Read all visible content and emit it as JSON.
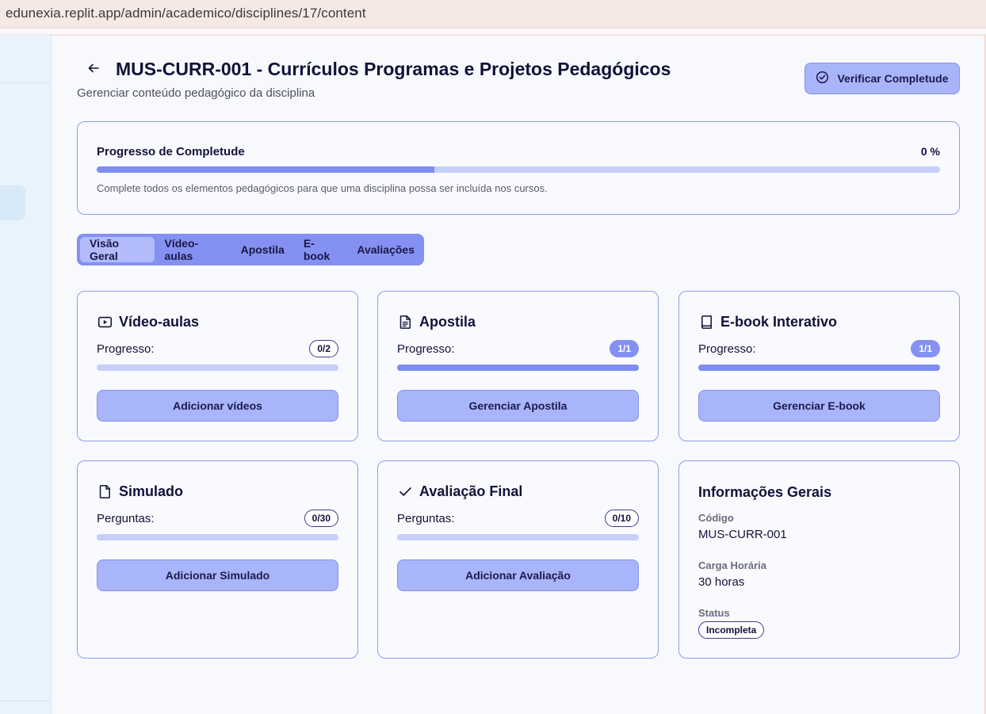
{
  "browser": {
    "url": "edunexia.replit.app/admin/academico/disciplines/17/content"
  },
  "header": {
    "title": "MUS-CURR-001 - Currículos Programas e Projetos Pedagógicos",
    "subtitle": "Gerenciar conteúdo pedagógico da disciplina",
    "verify_label": "Verificar Completude"
  },
  "progress": {
    "title": "Progresso de Completude",
    "percent_label": "0 %",
    "bar_fill_fraction": 0.4,
    "note": "Complete todos os elementos pedagógicos para que uma disciplina possa ser incluída nos cursos."
  },
  "tabs": [
    {
      "label": "Visão Geral",
      "active": true
    },
    {
      "label": "Vídeo-aulas",
      "active": false
    },
    {
      "label": "Apostila",
      "active": false
    },
    {
      "label": "E-book",
      "active": false
    },
    {
      "label": "Avaliações",
      "active": false
    }
  ],
  "cards": {
    "videos": {
      "title": "Vídeo-aulas",
      "icon": "video-icon",
      "label": "Progresso:",
      "badge": "0/2",
      "fill": 0,
      "button": "Adicionar vídeos"
    },
    "apostila": {
      "title": "Apostila",
      "icon": "document-text-icon",
      "label": "Progresso:",
      "badge": "1/1",
      "fill": 1,
      "button": "Gerenciar Apostila"
    },
    "ebook": {
      "title": "E-book Interativo",
      "icon": "book-icon",
      "label": "Progresso:",
      "badge": "1/1",
      "fill": 1,
      "button": "Gerenciar E-book"
    },
    "simulado": {
      "title": "Simulado",
      "icon": "file-icon",
      "label": "Perguntas:",
      "badge": "0/30",
      "fill": 0,
      "button": "Adicionar Simulado"
    },
    "avaliacao": {
      "title": "Avaliação Final",
      "icon": "check-icon",
      "label": "Perguntas:",
      "badge": "0/10",
      "fill": 0,
      "button": "Adicionar Avaliação"
    }
  },
  "info": {
    "title": "Informações Gerais",
    "code_label": "Código",
    "code_value": "MUS-CURR-001",
    "hours_label": "Carga Horária",
    "hours_value": "30 horas",
    "status_label": "Status",
    "status_value": "Incompleta"
  },
  "colors": {
    "accent": "#8491f2",
    "button_bg": "#a9b5fb",
    "track": "#c6cefa",
    "border": "#8f9de8"
  }
}
